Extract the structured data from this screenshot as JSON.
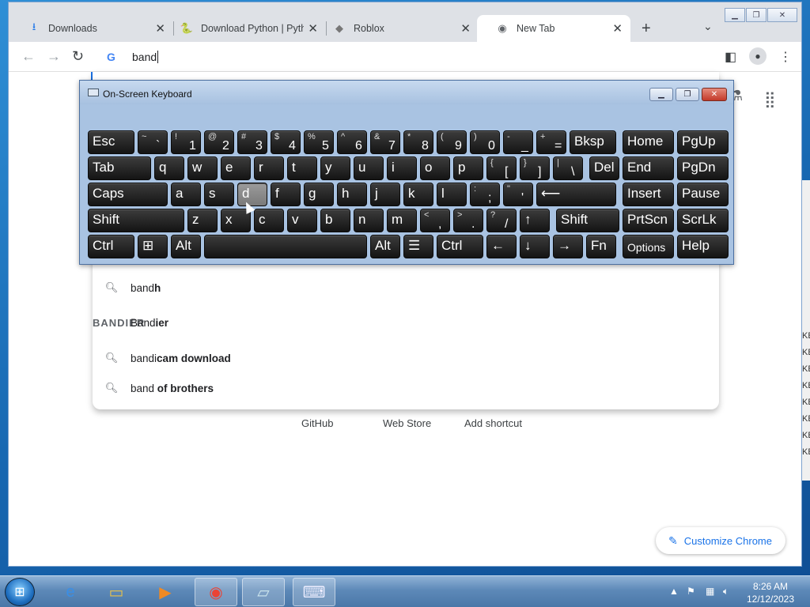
{
  "browser": {
    "tabs": [
      {
        "label": "Downloads",
        "icon": "download-icon"
      },
      {
        "label": "Download Python | Pyth",
        "icon": "python-icon"
      },
      {
        "label": "Roblox",
        "icon": "roblox-icon"
      },
      {
        "label": "New Tab",
        "icon": "chrome-icon"
      }
    ],
    "omnibox_text": "band",
    "suggestions": [
      {
        "prefix": "band",
        "suffix": "h",
        "icon": "search-icon"
      },
      {
        "prefix": "Band",
        "suffix": "ier",
        "icon": "bandier-logo",
        "logo_text": "BANDIER"
      },
      {
        "prefix": "bandi",
        "suffix": "cam download",
        "icon": "search-icon"
      },
      {
        "prefix": "band ",
        "suffix": "of brothers",
        "icon": "search-icon"
      }
    ],
    "shortcuts": [
      "GitHub",
      "Web Store",
      "Add shortcut"
    ],
    "customize_label": "Customize Chrome"
  },
  "osk": {
    "title": "On-Screen Keyboard",
    "row1": [
      {
        "m": "Esc"
      },
      {
        "s": "~",
        "b": "`"
      },
      {
        "s": "!",
        "b": "1"
      },
      {
        "s": "@",
        "b": "2"
      },
      {
        "s": "#",
        "b": "3"
      },
      {
        "s": "$",
        "b": "4"
      },
      {
        "s": "%",
        "b": "5"
      },
      {
        "s": "^",
        "b": "6"
      },
      {
        "s": "&",
        "b": "7"
      },
      {
        "s": "*",
        "b": "8"
      },
      {
        "s": "(",
        "b": "9"
      },
      {
        "s": ")",
        "b": "0"
      },
      {
        "s": "-",
        "b": "_"
      },
      {
        "s": "+",
        "b": "="
      },
      {
        "m": "Bksp"
      },
      {
        "m": "Home"
      },
      {
        "m": "PgUp"
      }
    ],
    "row2": [
      {
        "m": "Tab"
      },
      {
        "m": "q"
      },
      {
        "m": "w"
      },
      {
        "m": "e"
      },
      {
        "m": "r"
      },
      {
        "m": "t"
      },
      {
        "m": "y"
      },
      {
        "m": "u"
      },
      {
        "m": "i"
      },
      {
        "m": "o"
      },
      {
        "m": "p"
      },
      {
        "s": "{",
        "b": "["
      },
      {
        "s": "}",
        "b": "]"
      },
      {
        "s": "|",
        "b": "\\"
      },
      {
        "m": "Del"
      },
      {
        "m": "End"
      },
      {
        "m": "PgDn"
      }
    ],
    "row3": [
      {
        "m": "Caps"
      },
      {
        "m": "a"
      },
      {
        "m": "s"
      },
      {
        "m": "d"
      },
      {
        "m": "f"
      },
      {
        "m": "g"
      },
      {
        "m": "h"
      },
      {
        "m": "j"
      },
      {
        "m": "k"
      },
      {
        "m": "l"
      },
      {
        "s": ":",
        "b": ";"
      },
      {
        "s": "\"",
        "b": "'"
      },
      {
        "m": "⟵"
      },
      {
        "m": "Insert"
      },
      {
        "m": "Pause"
      }
    ],
    "row4": [
      {
        "m": "Shift"
      },
      {
        "m": "z"
      },
      {
        "m": "x"
      },
      {
        "m": "c"
      },
      {
        "m": "v"
      },
      {
        "m": "b"
      },
      {
        "m": "n"
      },
      {
        "m": "m"
      },
      {
        "s": "<",
        "b": ","
      },
      {
        "s": ">",
        "b": "."
      },
      {
        "s": "?",
        "b": "/"
      },
      {
        "m": "↑"
      },
      {
        "m": "Shift"
      },
      {
        "m": "PrtScn"
      },
      {
        "m": "ScrLk"
      }
    ],
    "row5": [
      {
        "m": "Ctrl"
      },
      {
        "m": "⊞"
      },
      {
        "m": "Alt"
      },
      {
        "m": ""
      },
      {
        "m": "Alt"
      },
      {
        "m": "☰"
      },
      {
        "m": "Ctrl"
      },
      {
        "m": "←"
      },
      {
        "m": "↓"
      },
      {
        "m": "→"
      },
      {
        "m": "Fn"
      },
      {
        "m": "Options"
      },
      {
        "m": "Help"
      }
    ],
    "pressed_key": "d"
  },
  "taskbar": {
    "apps": [
      "internet-explorer-icon",
      "file-explorer-icon",
      "media-player-icon",
      "chrome-icon",
      "notepad-icon",
      "osk-icon"
    ],
    "time": "8:26 AM",
    "date": "12/12/2023"
  },
  "background_window_chars": [
    "KE",
    "KE",
    "KE",
    "KE",
    "KE",
    "KE",
    "KE",
    "KE"
  ]
}
